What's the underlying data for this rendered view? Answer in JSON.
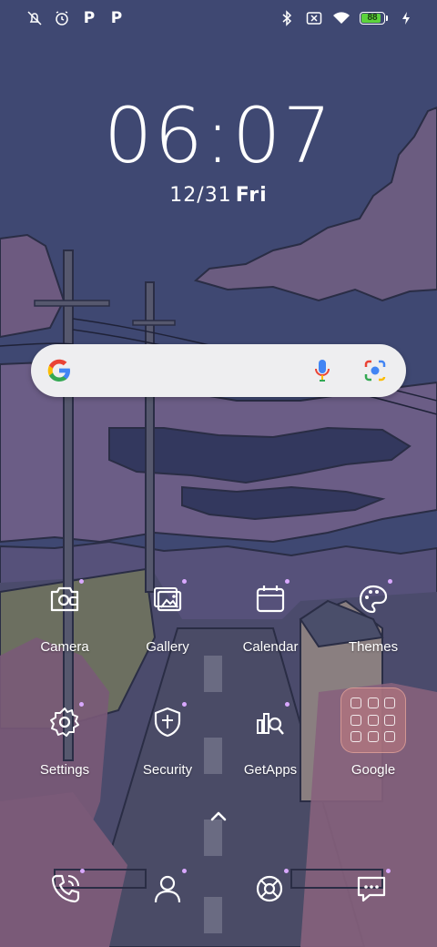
{
  "status_bar": {
    "left_icons": [
      "alarm-off-icon",
      "alarm-clock-icon",
      "p-notification-icon",
      "p-notification-icon"
    ],
    "p_glyph": "P",
    "right_icons": [
      "bluetooth-icon",
      "sim-no-signal-icon",
      "wifi-icon",
      "battery-icon",
      "charging-icon"
    ],
    "battery_level": "88",
    "battery_color": "#5cd33c"
  },
  "clock": {
    "time": "06:07",
    "date": "12/31",
    "day": "Fri"
  },
  "search": {
    "logo": "google-g-icon",
    "icons": [
      "microphone-icon",
      "google-lens-icon"
    ]
  },
  "apps": [
    {
      "label": "Camera",
      "icon": "camera-icon"
    },
    {
      "label": "Gallery",
      "icon": "gallery-icon"
    },
    {
      "label": "Calendar",
      "icon": "calendar-icon"
    },
    {
      "label": "Themes",
      "icon": "palette-icon"
    },
    {
      "label": "Settings",
      "icon": "gear-icon"
    },
    {
      "label": "Security",
      "icon": "shield-icon"
    },
    {
      "label": "GetApps",
      "icon": "getapps-icon"
    },
    {
      "label": "Google",
      "icon": "folder-icon"
    }
  ],
  "dock": [
    {
      "icon": "phone-icon"
    },
    {
      "icon": "contacts-icon"
    },
    {
      "icon": "browser-icon"
    },
    {
      "icon": "messages-icon"
    }
  ],
  "colors": {
    "sky": "#3f4872",
    "accent_dot": "#d9a8ff"
  }
}
